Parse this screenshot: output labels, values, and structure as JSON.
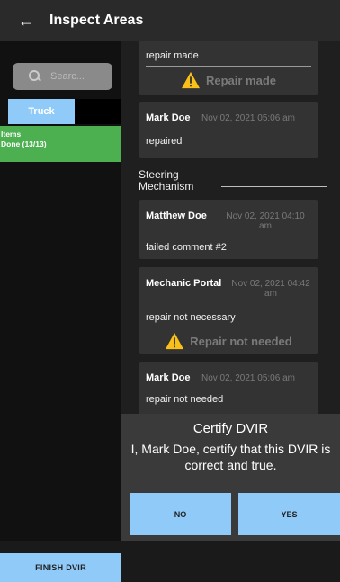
{
  "header": {
    "title": "Inspect Areas",
    "back_icon": "arrow-left-icon"
  },
  "sidebar": {
    "search_placeholder": "Searc...",
    "tab_label": "Truck",
    "group": {
      "line1": "Items",
      "line2": "Done (13/13)"
    },
    "finish_label": "FINISH DVIR"
  },
  "comments": {
    "top_partial_text": "repair made",
    "top_status": "Repair made",
    "c1": {
      "author": "Mark Doe",
      "time": "Nov 02, 2021  05:06 am",
      "text": "repaired"
    },
    "section_title": "Steering Mechanism",
    "c2": {
      "author": "Matthew Doe",
      "time_line1": "Nov 02, 2021  04:10",
      "time_line2": "am",
      "text": "failed comment #2"
    },
    "c3": {
      "author": "Mechanic Portal",
      "time_line1": "Nov 02, 2021  04:42",
      "time_line2": "am",
      "text": "repair not necessary",
      "status": "Repair not needed"
    },
    "c4": {
      "author": "Mark Doe",
      "time": "Nov 02, 2021  05:06 am",
      "text": "repair not needed"
    }
  },
  "certify": {
    "title": "Certify DVIR",
    "body": "I, Mark Doe, certify that this DVIR is correct and true.",
    "no_label": "NO",
    "yes_label": "YES"
  },
  "colors": {
    "accent_blue": "#90caf9",
    "done_green": "#4caf50",
    "warning_yellow": "#f9c01a"
  }
}
